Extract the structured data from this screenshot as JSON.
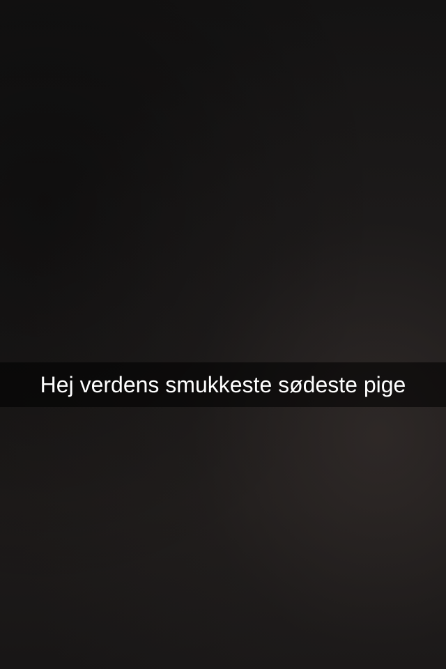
{
  "snap": {
    "caption": "Hej verdens smukkeste sødeste pige"
  }
}
